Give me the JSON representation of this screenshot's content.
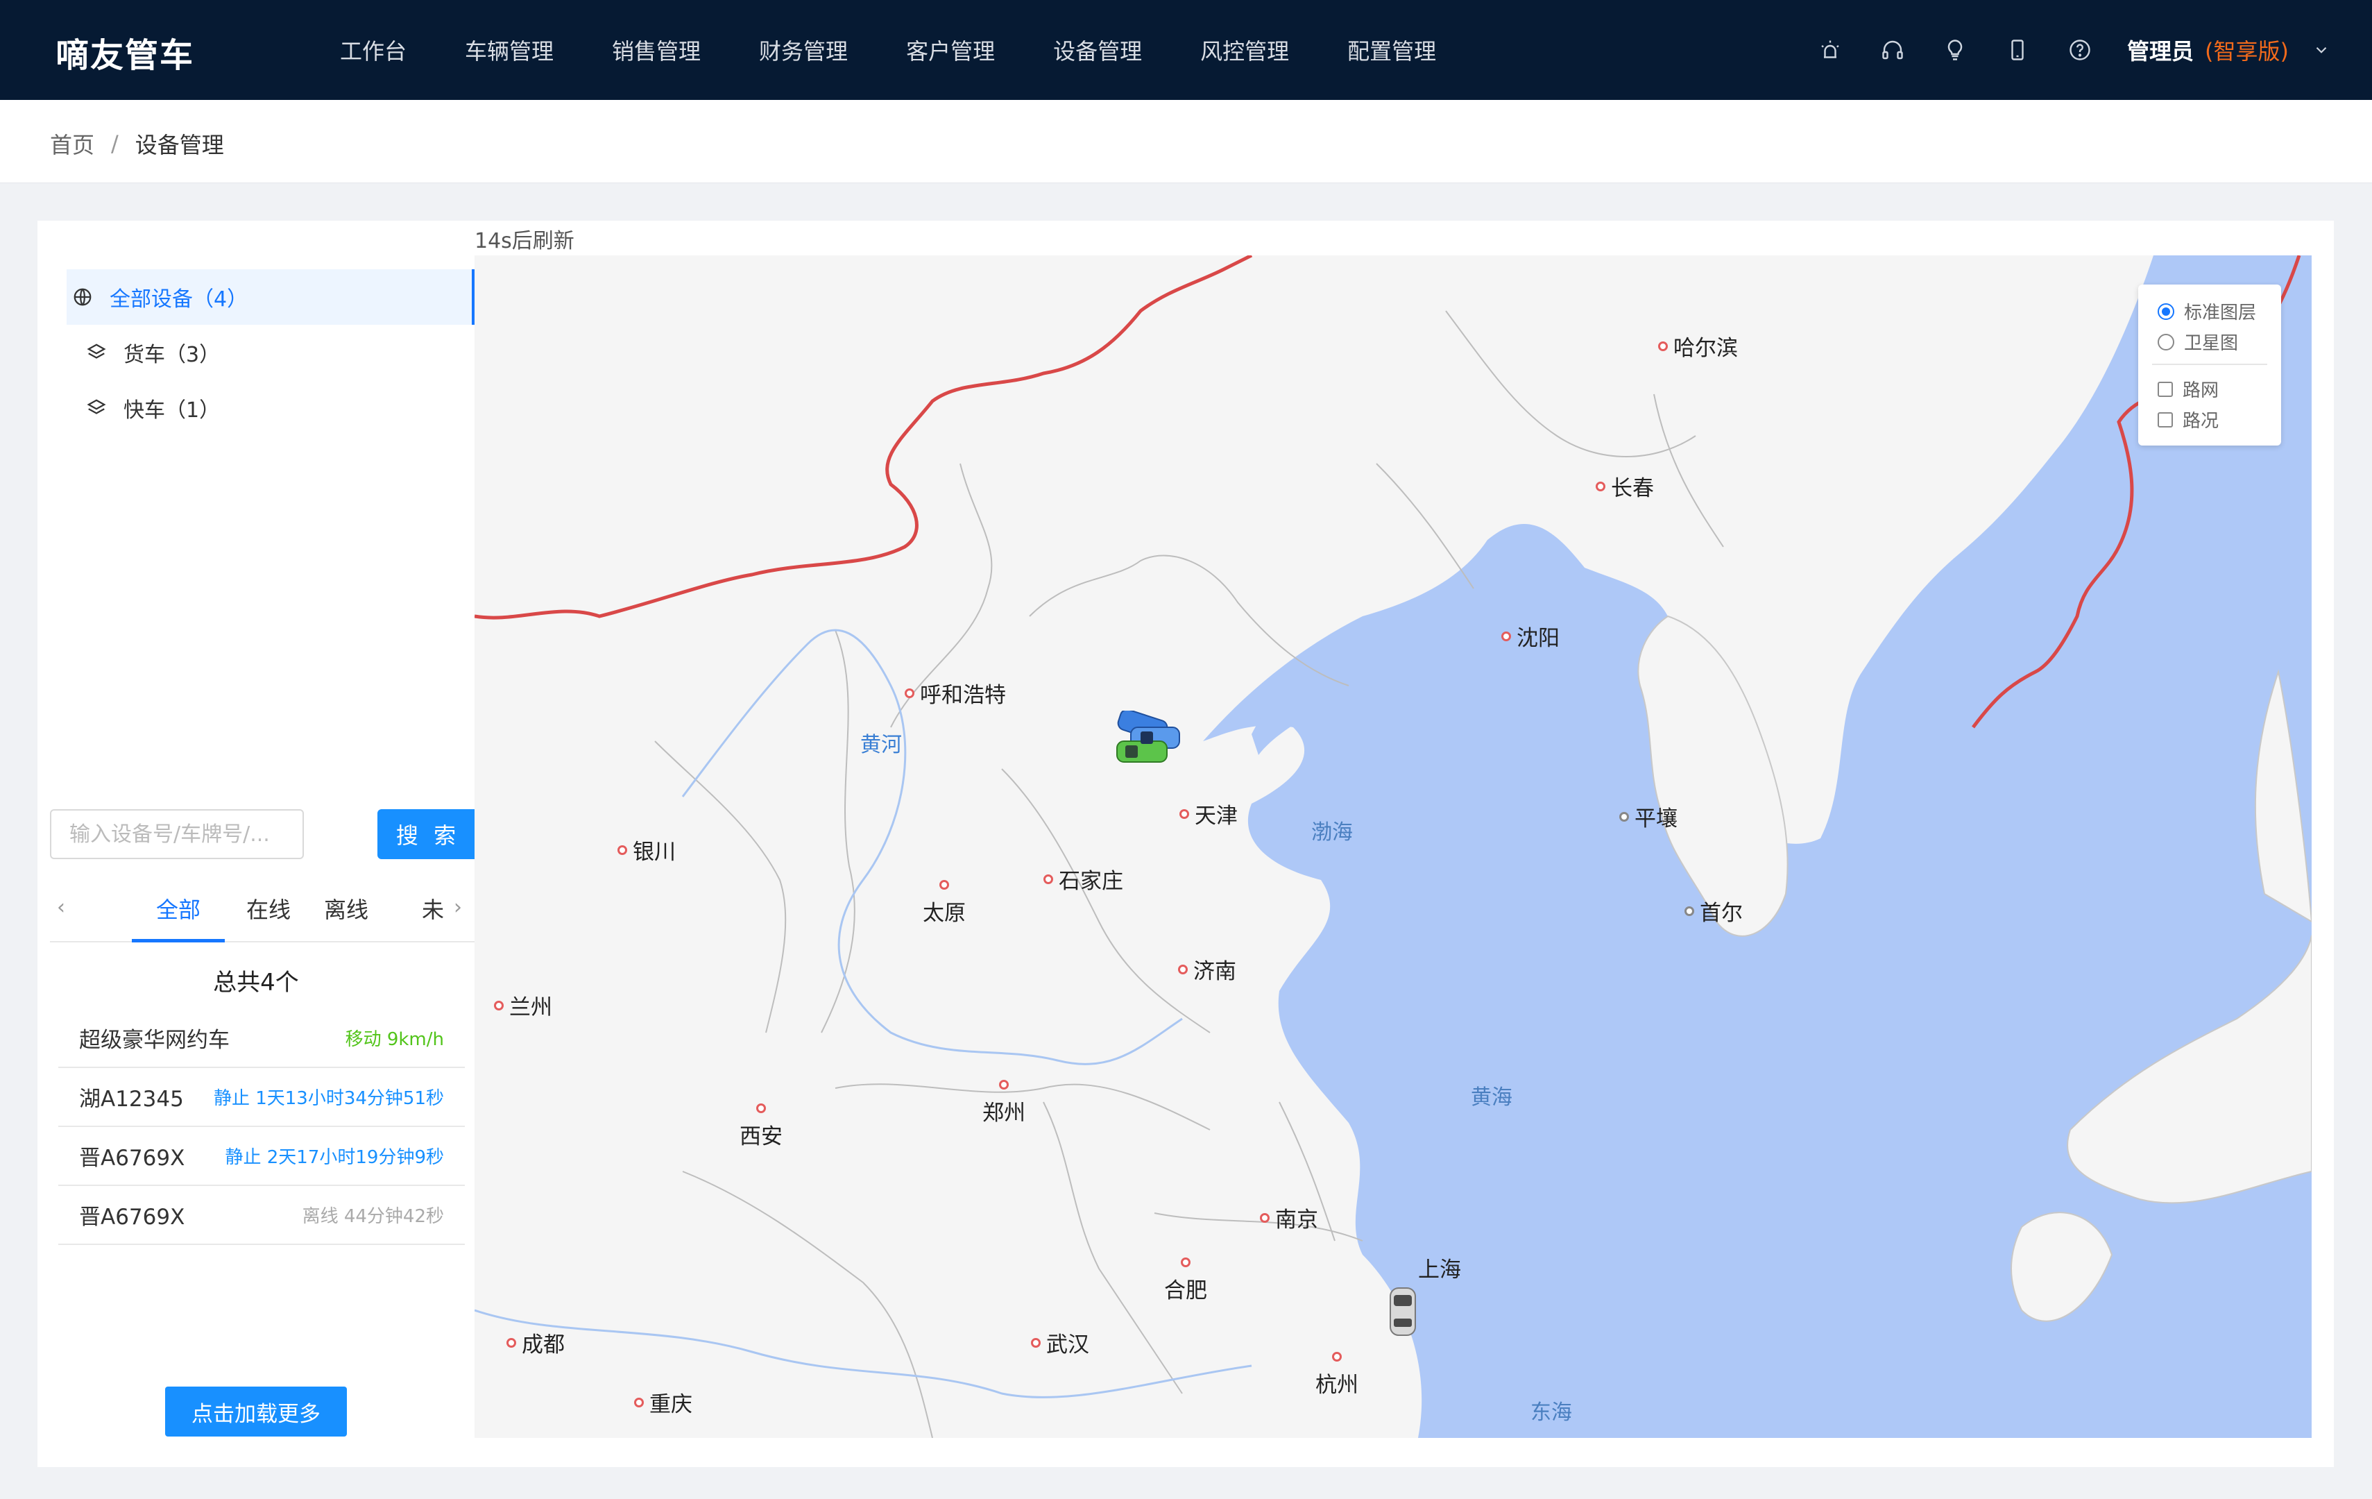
{
  "app": {
    "brand": "嘀友管车"
  },
  "nav": {
    "items": [
      "工作台",
      "车辆管理",
      "销售管理",
      "财务管理",
      "客户管理",
      "设备管理",
      "风控管理",
      "配置管理"
    ],
    "icons": [
      "alarm-icon",
      "headset-icon",
      "bulb-icon",
      "phone-icon",
      "help-icon"
    ],
    "user": "管理员",
    "edition": "(智享版)"
  },
  "breadcrumb": {
    "home": "首页",
    "separator": "/",
    "current": "设备管理"
  },
  "tree": {
    "items": [
      {
        "label": "全部设备（4）",
        "icon": "globe-icon"
      },
      {
        "label": "货车（3）",
        "icon": "layers-icon"
      },
      {
        "label": "快车（1）",
        "icon": "layers-icon"
      }
    ]
  },
  "search": {
    "placeholder": "输入设备号/车牌号/...",
    "button": "搜 索"
  },
  "tabs": {
    "items": [
      "全部",
      "在线",
      "离线",
      "未"
    ],
    "active": "全部"
  },
  "total": "总共4个",
  "devices": [
    {
      "name": "超级豪华网约车",
      "status": "移动  9km/h",
      "state": "move"
    },
    {
      "name": "湖A12345",
      "status": "静止  1天13小时34分钟51秒",
      "state": "still"
    },
    {
      "name": "晋A6769X",
      "status": "静止  2天17小时19分钟9秒",
      "state": "still"
    },
    {
      "name": "晋A6769X",
      "status": "离线  44分钟42秒",
      "state": "off"
    }
  ],
  "load_more": "点击加载更多",
  "map": {
    "refresh": "14s后刷新",
    "layers": {
      "standard": "标准图层",
      "satellite": "卫星图",
      "roads": "路网",
      "traffic": "路况"
    },
    "cities": {
      "harbin": "哈尔滨",
      "changchun": "长春",
      "shenyang": "沈阳",
      "hohhot": "呼和浩特",
      "tianjin": "天津",
      "pyongyang": "平壤",
      "seoul": "首尔",
      "yinchuan": "银川",
      "shijiazhuang": "石家庄",
      "taiyuan": "太原",
      "jinan": "济南",
      "lanzhou": "兰州",
      "xian": "西安",
      "zhengzhou": "郑州",
      "nanjing": "南京",
      "hefei": "合肥",
      "shanghai": "上海",
      "chengdu": "成都",
      "wuhan": "武汉",
      "hangzhou": "杭州",
      "chongqing": "重庆"
    },
    "water": {
      "bohai": "渤海",
      "yellow_sea": "黄海",
      "east_sea": "东海",
      "yellow_river": "黄河"
    },
    "colors": {
      "land": "#f5f5f5",
      "sea": "#aec8f7",
      "border": "#d94848",
      "accent": "#1677ff"
    }
  }
}
